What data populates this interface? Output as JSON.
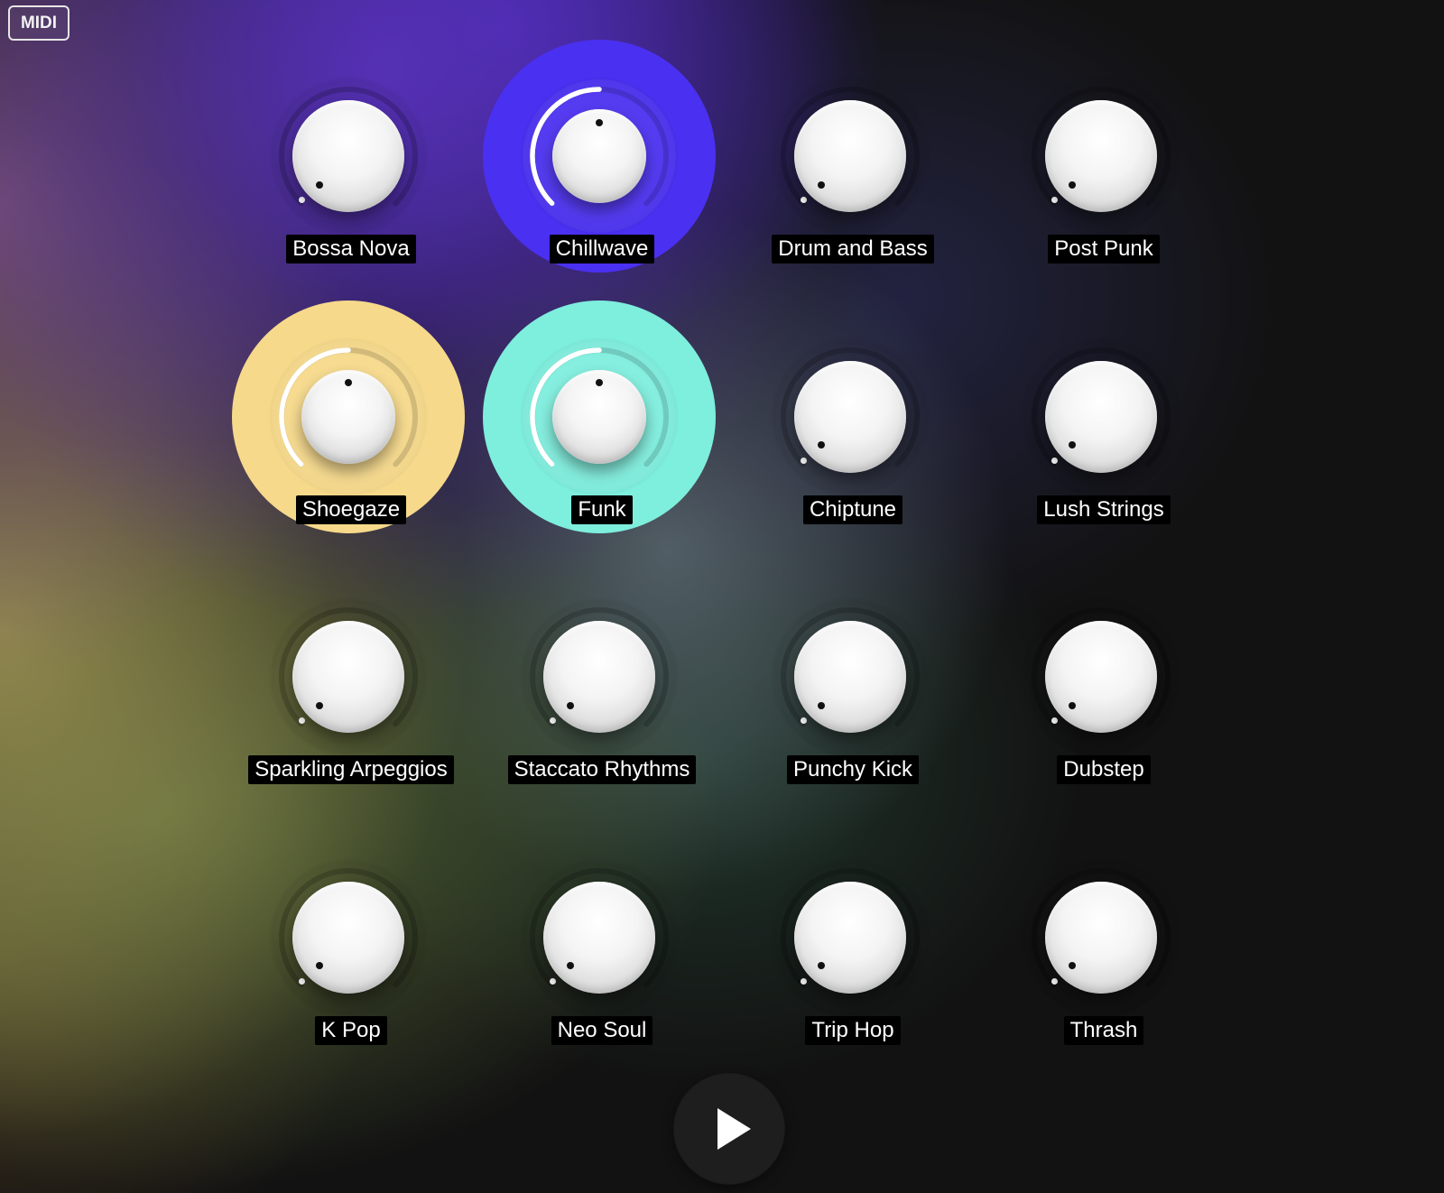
{
  "midi_button": {
    "label": "MIDI"
  },
  "knobs": [
    {
      "label": "Bossa Nova",
      "active": false,
      "value": 0.0
    },
    {
      "label": "Chillwave",
      "active": true,
      "value": 0.5,
      "glow_color": "#4a30f0"
    },
    {
      "label": "Drum and Bass",
      "active": false,
      "value": 0.0
    },
    {
      "label": "Post Punk",
      "active": false,
      "value": 0.0
    },
    {
      "label": "Shoegaze",
      "active": true,
      "value": 0.5,
      "glow_color": "#f6d98a"
    },
    {
      "label": "Funk",
      "active": true,
      "value": 0.5,
      "glow_color": "#7eeedd"
    },
    {
      "label": "Chiptune",
      "active": false,
      "value": 0.0
    },
    {
      "label": "Lush Strings",
      "active": false,
      "value": 0.0
    },
    {
      "label": "Sparkling Arpeggios",
      "active": false,
      "value": 0.0
    },
    {
      "label": "Staccato Rhythms",
      "active": false,
      "value": 0.0
    },
    {
      "label": "Punchy Kick",
      "active": false,
      "value": 0.0
    },
    {
      "label": "Dubstep",
      "active": false,
      "value": 0.0
    },
    {
      "label": "K Pop",
      "active": false,
      "value": 0.0
    },
    {
      "label": "Neo Soul",
      "active": false,
      "value": 0.0
    },
    {
      "label": "Trip Hop",
      "active": false,
      "value": 0.0
    },
    {
      "label": "Thrash",
      "active": false,
      "value": 0.0
    }
  ],
  "play_button": {
    "icon": "play-icon"
  }
}
